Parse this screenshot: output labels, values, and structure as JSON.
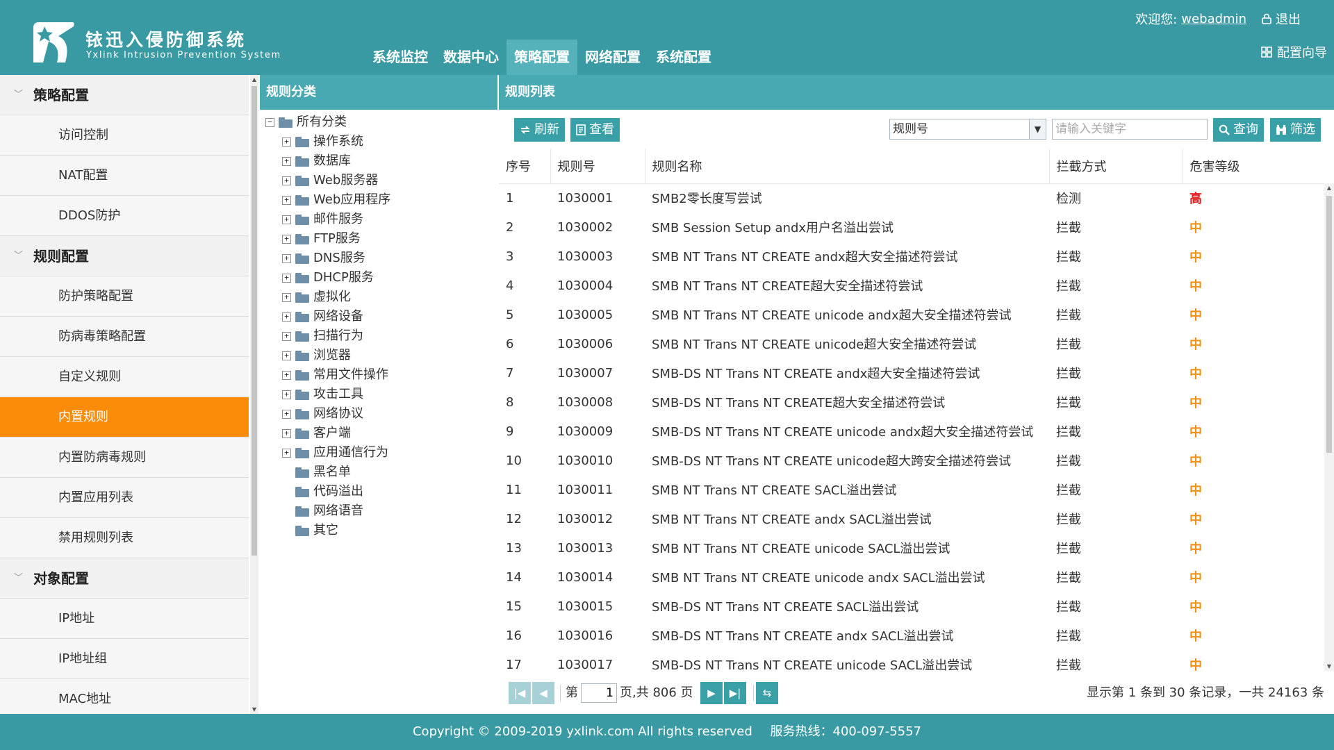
{
  "brand": {
    "cn": "铱迅入侵防御系统",
    "en": "Yxlink  Intrusion  Prevention  System"
  },
  "topnav": [
    "系统监控",
    "数据中心",
    "策略配置",
    "网络配置",
    "系统配置"
  ],
  "topnav_active": "策略配置",
  "user": {
    "welcome": "欢迎您:",
    "name": "webadmin",
    "logout": "退出",
    "wizard": "配置向导"
  },
  "sidebar": {
    "groups": [
      {
        "title": "策略配置",
        "items": [
          "访问控制",
          "NAT配置",
          "DDOS防护"
        ]
      },
      {
        "title": "规则配置",
        "items": [
          "防护策略配置",
          "防病毒策略配置",
          "自定义规则",
          "内置规则",
          "内置防病毒规则",
          "内置应用列表",
          "禁用规则列表"
        ]
      },
      {
        "title": "对象配置",
        "items": [
          "IP地址",
          "IP地址组",
          "MAC地址"
        ]
      }
    ],
    "active": "内置规则"
  },
  "category": {
    "title": "规则分类",
    "root": "所有分类",
    "expandable": [
      "操作系统",
      "数据库",
      "Web服务器",
      "Web应用程序",
      "邮件服务",
      "FTP服务",
      "DNS服务",
      "DHCP服务",
      "虚拟化",
      "网络设备",
      "扫描行为",
      "浏览器",
      "常用文件操作",
      "攻击工具",
      "网络协议",
      "客户端",
      "应用通信行为"
    ],
    "leaves": [
      "黑名单",
      "代码溢出",
      "网络语音",
      "其它"
    ]
  },
  "rules": {
    "title": "规则列表",
    "refresh": "刷新",
    "view": "查看",
    "search_field": "规则号",
    "search_placeholder": "请输入关键字",
    "query": "查询",
    "filter": "筛选",
    "columns": [
      "序号",
      "规则号",
      "规则名称",
      "拦截方式",
      "危害等级"
    ],
    "rows": [
      [
        "1",
        "1030001",
        "SMB2零长度写尝试",
        "检测",
        "高"
      ],
      [
        "2",
        "1030002",
        "SMB Session Setup andx用户名溢出尝试",
        "拦截",
        "中"
      ],
      [
        "3",
        "1030003",
        "SMB NT Trans NT CREATE andx超大安全描述符尝试",
        "拦截",
        "中"
      ],
      [
        "4",
        "1030004",
        "SMB NT Trans NT CREATE超大安全描述符尝试",
        "拦截",
        "中"
      ],
      [
        "5",
        "1030005",
        "SMB NT Trans NT CREATE unicode andx超大安全描述符尝试",
        "拦截",
        "中"
      ],
      [
        "6",
        "1030006",
        "SMB NT Trans NT CREATE unicode超大安全描述符尝试",
        "拦截",
        "中"
      ],
      [
        "7",
        "1030007",
        "SMB-DS NT Trans NT CREATE andx超大安全描述符尝试",
        "拦截",
        "中"
      ],
      [
        "8",
        "1030008",
        "SMB-DS NT Trans NT CREATE超大安全描述符尝试",
        "拦截",
        "中"
      ],
      [
        "9",
        "1030009",
        "SMB-DS NT Trans NT CREATE unicode andx超大安全描述符尝试",
        "拦截",
        "中"
      ],
      [
        "10",
        "1030010",
        "SMB-DS NT Trans NT CREATE unicode超大跨安全描述符尝试",
        "拦截",
        "中"
      ],
      [
        "11",
        "1030011",
        "SMB NT Trans NT CREATE SACL溢出尝试",
        "拦截",
        "中"
      ],
      [
        "12",
        "1030012",
        "SMB NT Trans NT CREATE andx SACL溢出尝试",
        "拦截",
        "中"
      ],
      [
        "13",
        "1030013",
        "SMB NT Trans NT CREATE unicode SACL溢出尝试",
        "拦截",
        "中"
      ],
      [
        "14",
        "1030014",
        "SMB NT Trans NT CREATE unicode andx SACL溢出尝试",
        "拦截",
        "中"
      ],
      [
        "15",
        "1030015",
        "SMB-DS NT Trans NT CREATE SACL溢出尝试",
        "拦截",
        "中"
      ],
      [
        "16",
        "1030016",
        "SMB-DS NT Trans NT CREATE andx SACL溢出尝试",
        "拦截",
        "中"
      ],
      [
        "17",
        "1030017",
        "SMB-DS NT Trans NT CREATE unicode SACL溢出尝试",
        "拦截",
        "中"
      ]
    ],
    "level_colors": {
      "高": "#e02020",
      "中": "#f09010"
    }
  },
  "pager": {
    "prefix": "第",
    "page": "1",
    "suffix": "页,共 806 页",
    "info": "显示第 1 条到 30 条记录，一共 24163 条"
  },
  "footer": {
    "copyright": "Copyright © 2009-2019 yxlink.com All rights reserved",
    "hotline": "服务热线：400-097-5557"
  },
  "colors": {
    "header": "#3a9aa3",
    "panel_title": "#49a9b2",
    "active_item": "#fa8c0a",
    "button": "#3aa0a8"
  }
}
